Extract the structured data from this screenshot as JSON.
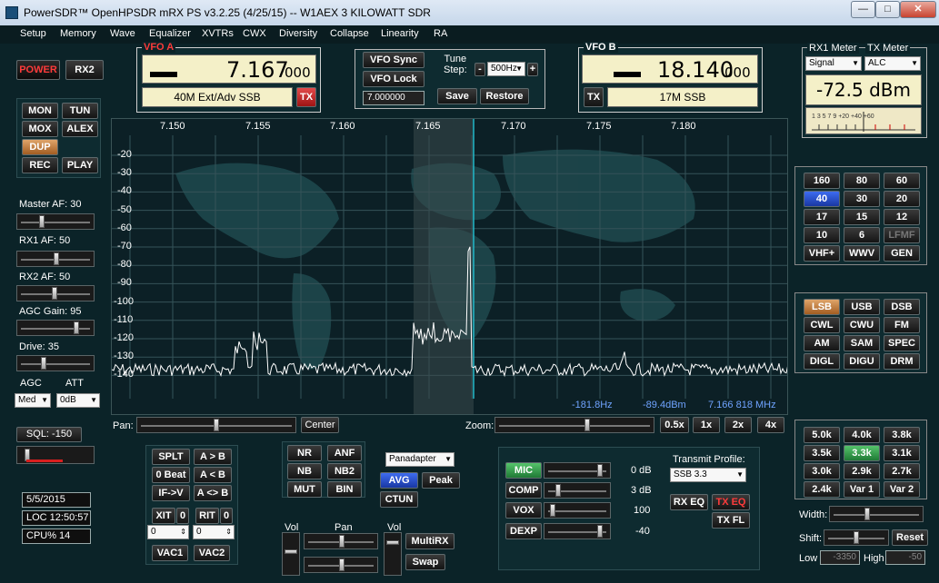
{
  "window": {
    "title": "PowerSDR™ OpenHPSDR mRX PS v3.2.25 (4/25/15)   --   W1AEX 3 KILOWATT SDR",
    "min": "—",
    "max": "□",
    "close": "✕"
  },
  "menu": [
    "Setup",
    "Memory",
    "Wave",
    "Equalizer",
    "XVTRs",
    "CWX",
    "Diversity",
    "Collapse",
    "Linearity",
    "RA"
  ],
  "power": {
    "power": "POWER",
    "rx2": "RX2"
  },
  "mode_buttons": {
    "mon": "MON",
    "tun": "TUN",
    "mox": "MOX",
    "alex": "ALEX",
    "dup": "DUP",
    "rec": "REC",
    "play": "PLAY"
  },
  "left_controls": {
    "master_af": "Master AF:  30",
    "rx1_af": "RX1 AF:  50",
    "rx2_af": "RX2 AF:  50",
    "agc_gain": "AGC Gain:  95",
    "drive": "Drive:  35",
    "agc": "AGC",
    "att": "ATT",
    "agc_value": "Med",
    "att_value": "0dB",
    "sql": "SQL: -150"
  },
  "status": {
    "date": "5/5/2015",
    "loc": "LOC 12:50:57",
    "cpu": "CPU%  14"
  },
  "vfo_a": {
    "label": "VFO A",
    "freq_main": "7.167",
    "freq_sub": "000",
    "band": "40M Ext/Adv SSB",
    "tx": "TX"
  },
  "vfo_sync": {
    "sync": "VFO Sync",
    "lock": "VFO Lock",
    "value": "7.000000",
    "tune_label": "Tune\nStep:",
    "tune_label_1": "Tune",
    "tune_label_2": "Step:",
    "minus": "-",
    "step": "500Hz",
    "plus": "+",
    "save": "Save",
    "restore": "Restore"
  },
  "vfo_b": {
    "label": "VFO B",
    "freq_main": "18.140",
    "freq_sub": "000",
    "band": "17M SSB",
    "tx": "TX"
  },
  "meter": {
    "rx1": "RX1 Meter",
    "tx": "TX Meter",
    "rx1_value": "Signal",
    "tx_value": "ALC",
    "reading": "-72.5 dBm",
    "scale": "1  3  5  7  9  +20  +40  +60"
  },
  "freq_axis": [
    "7.150",
    "7.155",
    "7.160",
    "7.165",
    "7.170",
    "7.175",
    "7.180"
  ],
  "db_axis": [
    "-20",
    "-30",
    "-40",
    "-50",
    "-60",
    "-70",
    "-80",
    "-90",
    "-100",
    "-110",
    "-120",
    "-130",
    "-140"
  ],
  "cursor_readout": {
    "offset": "-181.8Hz",
    "level": "-89.4dBm",
    "freq": "7.166 818 MHz"
  },
  "bands": [
    "160",
    "80",
    "60",
    "40",
    "30",
    "20",
    "17",
    "15",
    "12",
    "10",
    "6",
    "LFMF",
    "VHF+",
    "WWV",
    "GEN"
  ],
  "modes": [
    "LSB",
    "USB",
    "DSB",
    "CWL",
    "CWU",
    "FM",
    "AM",
    "SAM",
    "SPEC",
    "DIGL",
    "DIGU",
    "DRM"
  ],
  "filters": [
    "5.0k",
    "4.0k",
    "3.8k",
    "3.5k",
    "3.3k",
    "3.1k",
    "3.0k",
    "2.9k",
    "2.7k",
    "2.4k",
    "Var 1",
    "Var 2"
  ],
  "filter_controls": {
    "width": "Width:",
    "shift": "Shift:",
    "reset": "Reset",
    "low": "Low",
    "low_value": "-3350",
    "high": "High",
    "high_value": "-50"
  },
  "pan_zoom": {
    "pan": "Pan:",
    "center": "Center",
    "zoom": "Zoom:",
    "z05": "0.5x",
    "z1": "1x",
    "z2": "2x",
    "z4": "4x"
  },
  "split": {
    "splt": "SPLT",
    "a_to_b": "A > B",
    "zero_beat": "0 Beat",
    "a_from_b": "A < B",
    "if_v": "IF->V",
    "swap_ab": "A <> B",
    "xit": "XIT",
    "xit_v": "0",
    "rit": "RIT",
    "rit_v": "0",
    "xit_num": "0",
    "rit_num": "0",
    "vac1": "VAC1",
    "vac2": "VAC2"
  },
  "dsp": {
    "nr": "NR",
    "anf": "ANF",
    "nb": "NB",
    "nb2": "NB2",
    "mut": "MUT",
    "bin": "BIN",
    "display": "Panadapter",
    "avg": "AVG",
    "peak": "Peak",
    "ctun": "CTUN"
  },
  "mix": {
    "vol1": "Vol",
    "pan": "Pan",
    "vol2": "Vol",
    "multirx": "MultiRX",
    "swap": "Swap"
  },
  "tx": {
    "mic": "MIC",
    "mic_v": "0 dB",
    "comp": "COMP",
    "comp_v": "3 dB",
    "vox": "VOX",
    "vox_v": "100",
    "dexp": "DEXP",
    "dexp_v": "-40",
    "profile_label": "Transmit Profile:",
    "profile": "SSB 3.3",
    "rxeq": "RX EQ",
    "txeq": "TX EQ",
    "txfl": "TX FL"
  },
  "colors": {
    "accent_red": "#e32020",
    "vfo_bg": "#f4f0c8",
    "spectrum_line": "#ffffff",
    "passband": "#3a4a4d"
  }
}
